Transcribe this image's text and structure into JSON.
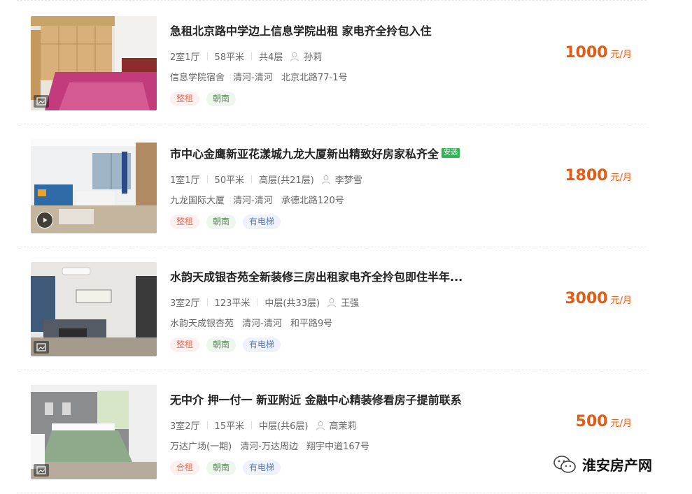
{
  "listings": [
    {
      "title": "急租北京路中学边上信息学院出租 家电齐全拎包入住",
      "layout": "2室1厅",
      "area": "58平米",
      "floor": "共4层",
      "agent": "孙莉",
      "community": "信息学院宿舍",
      "district": "清河-清河",
      "street": "北京北路77-1号",
      "tags": [
        "整租",
        "朝南"
      ],
      "price": "1000",
      "price_unit": "元/月",
      "media": "image-icon"
    },
    {
      "title": "市中心金鹰新亚花漾城九龙大厦新出精致好房家私齐全",
      "badge": "安选",
      "layout": "1室1厅",
      "area": "50平米",
      "floor": "高层(共21层)",
      "agent": "李梦雪",
      "community": "九龙国际大厦",
      "district": "清河-清河",
      "street": "承德北路120号",
      "tags": [
        "整租",
        "朝南",
        "有电梯"
      ],
      "price": "1800",
      "price_unit": "元/月",
      "media": "play-icon"
    },
    {
      "title": "水韵天成银杏苑全新装修三房出租家电齐全拎包即住半年...",
      "layout": "3室2厅",
      "area": "123平米",
      "floor": "中层(共33层)",
      "agent": "王强",
      "community": "水韵天成银杏苑",
      "district": "清河-清河",
      "street": "和平路9号",
      "tags": [
        "整租",
        "朝南",
        "有电梯"
      ],
      "price": "3000",
      "price_unit": "元/月",
      "media": "image-icon"
    },
    {
      "title": "无中介 押一付一 新亚附近 金融中心精装修看房子提前联系",
      "layout": "3室2厅",
      "area": "15平米",
      "floor": "中层(共6层)",
      "agent": "高茉莉",
      "community": "万达广场(一期)",
      "district": "清河-万达周边",
      "street": "翔宇中道167号",
      "tags": [
        "合租",
        "朝南",
        "有电梯"
      ],
      "price": "500",
      "price_unit": "元/月",
      "media": "image-icon"
    }
  ],
  "watermark": {
    "text": "淮安房产网",
    "icon": "wechat-icon"
  },
  "colors": {
    "price": "#e55a13",
    "anxuan_badge": "#2fb456",
    "tag_red": "#e8735a",
    "tag_green": "#5b8a5b",
    "tag_blue": "#5d7fb8"
  }
}
